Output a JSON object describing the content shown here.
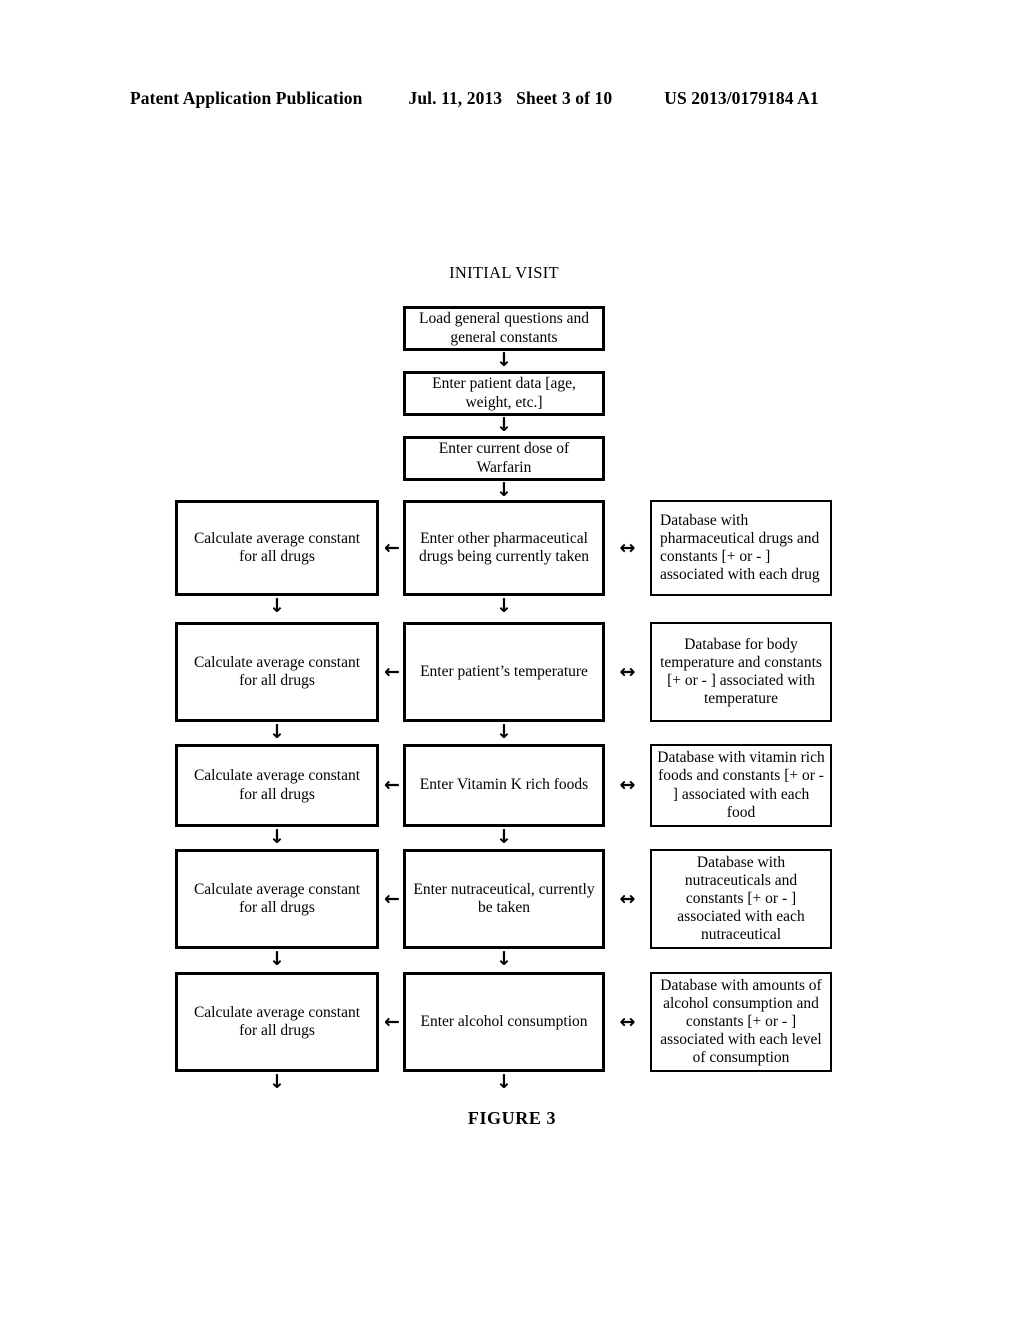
{
  "header": {
    "publication": "Patent Application Publication",
    "date": "Jul. 11, 2013",
    "sheet": "Sheet 3 of 10",
    "patent_number": "US 2013/0179184 A1"
  },
  "figure": {
    "title": "INITIAL VISIT",
    "caption": "FIGURE 3"
  },
  "icons": {
    "arrow_down": "↓",
    "arrow_left": "←",
    "arrow_both": "↔"
  },
  "flow": {
    "top_steps": [
      {
        "text": "Load general questions and general constants"
      },
      {
        "text": "Enter patient data [age, weight, etc.]"
      },
      {
        "text": "Enter current dose of Warfarin"
      }
    ],
    "rows": [
      {
        "calculate": "Calculate average constant for all drugs",
        "enter": "Enter other pharmaceutical drugs being currently taken",
        "database": "Database with pharmaceutical drugs and constants [+ or - ] associated with each drug",
        "database_align": "left"
      },
      {
        "calculate": "Calculate average constant for all drugs",
        "enter": "Enter patient’s temperature",
        "database": "Database for body temperature and constants [+ or - ] associated with temperature",
        "database_align": "center"
      },
      {
        "calculate": "Calculate average constant for all drugs",
        "enter": "Enter Vitamin K rich foods",
        "database": "Database with vitamin rich foods and constants [+ or - ] associated with each food",
        "database_align": "center"
      },
      {
        "calculate": "Calculate average constant for all drugs",
        "enter": "Enter nutraceutical, currently be taken",
        "database": "Database with nutraceuticals and constants [+ or - ] associated with each nutraceutical",
        "database_align": "center"
      },
      {
        "calculate": "Calculate average constant for all drugs",
        "enter": "Enter alcohol consumption",
        "database": "Database with amounts of alcohol consumption and constants [+ or - ] associated with each level of consumption",
        "database_align": "center"
      }
    ]
  }
}
